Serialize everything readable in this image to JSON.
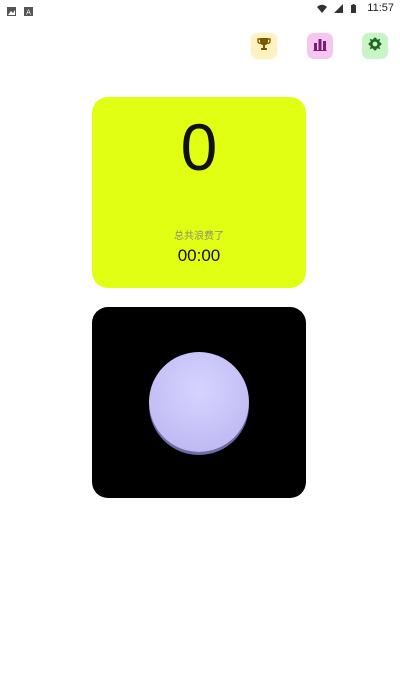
{
  "status_bar": {
    "time": "11:57",
    "left_icons": [
      "image-icon",
      "a-icon"
    ],
    "right_icons": [
      "wifi-icon",
      "signal-icon",
      "battery-icon"
    ]
  },
  "toolbar": {
    "trophy_icon": "trophy-icon",
    "stats_icon": "bar-chart-icon",
    "settings_icon": "gear-icon"
  },
  "stats": {
    "count": "0",
    "wasted_label": "总共浪费了",
    "timer": "00:00",
    "card_color": "#e1ff12"
  },
  "button_card": {
    "background": "#000000",
    "button_color": "#c6c2f7"
  }
}
